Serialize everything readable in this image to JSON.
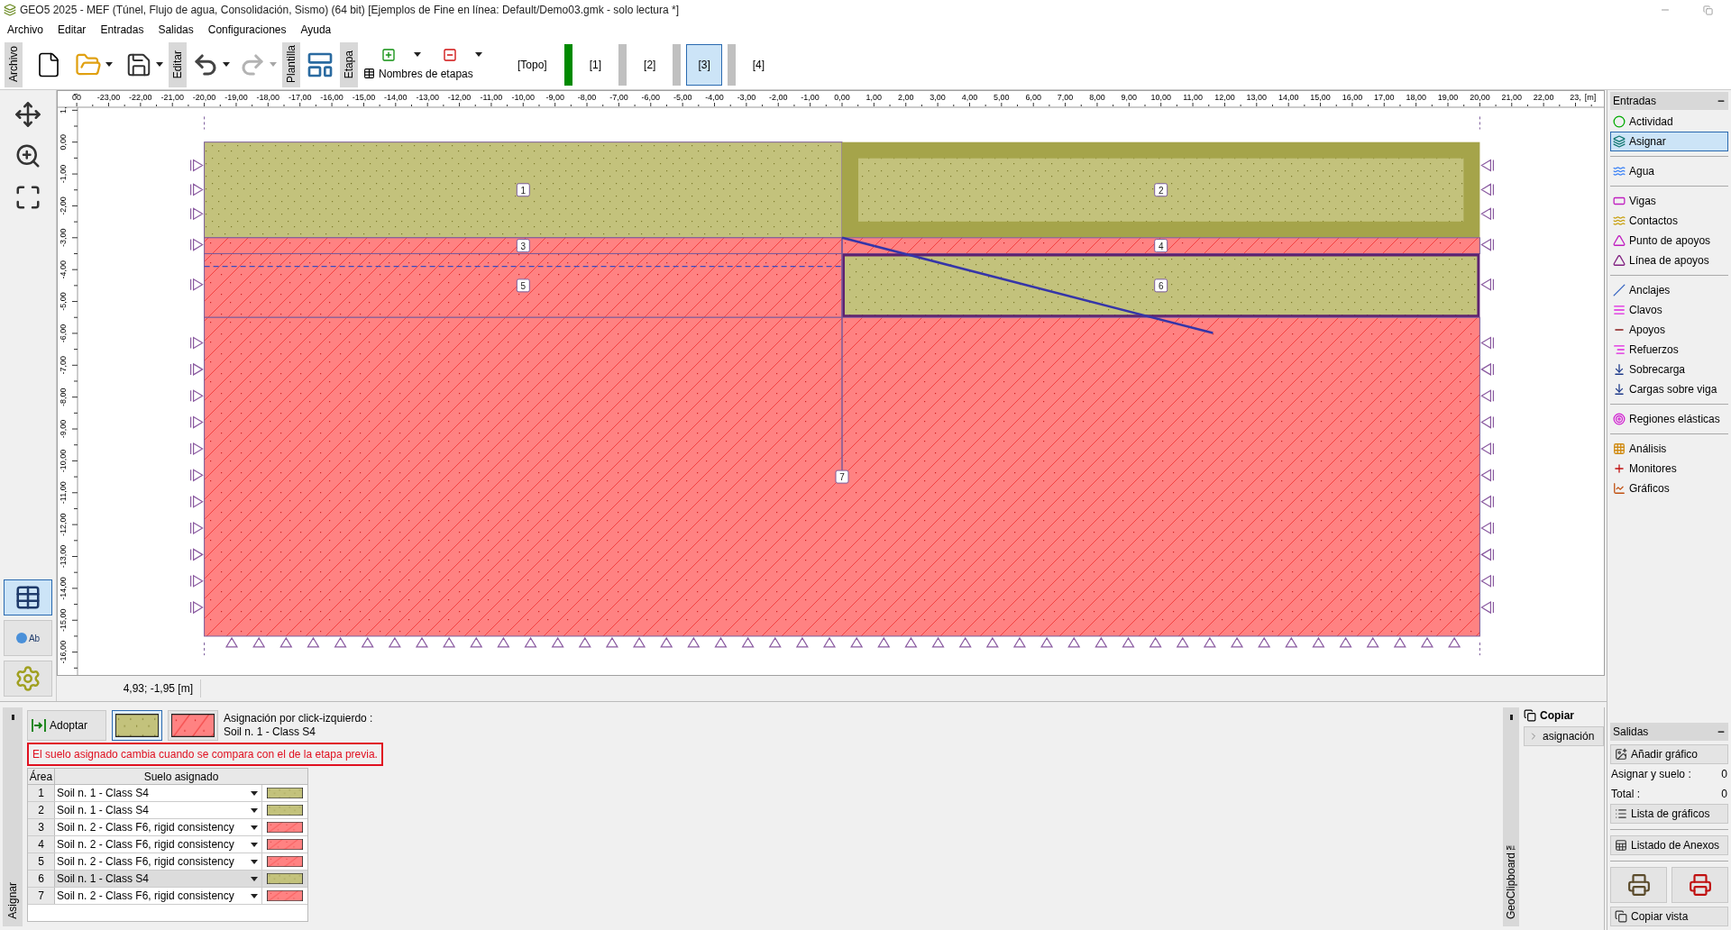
{
  "window": {
    "title": "GEO5 2025 - MEF (Túnel, Flujo de agua, Consolidación, Sismo) (64 bit) [Ejemplos de Fine en línea: Default/Demo03.gmk - solo lectura *]"
  },
  "menu": [
    "Archivo",
    "Editar",
    "Entradas",
    "Salidas",
    "Configuraciones",
    "Ayuda"
  ],
  "toolbar": {
    "groups": [
      "Archivo",
      "Editar",
      "Plantilla",
      "Etapa"
    ],
    "stage_names_button": "Nombres de etapas",
    "stages": [
      {
        "label": "[Topo]",
        "selected": false
      },
      {
        "label": "[1]",
        "selected": false,
        "color": "#008a00"
      },
      {
        "label": "[2]",
        "selected": false,
        "color": "#c0c0c0"
      },
      {
        "label": "[3]",
        "selected": true,
        "color": "#c0c0c0"
      },
      {
        "label": "[4]",
        "selected": false,
        "color": "#c0c0c0"
      }
    ]
  },
  "view_modes": [
    {
      "kind": "table",
      "selected": true
    },
    {
      "kind": "labels",
      "selected": false,
      "text": "Ab"
    },
    {
      "kind": "settings",
      "selected": false
    }
  ],
  "canvas": {
    "x_labels": [
      "00",
      "-23,00",
      "-22,00",
      "-21,00",
      "-20,00",
      "-19,00",
      "-18,00",
      "-17,00",
      "-16,00",
      "-15,00",
      "-14,00",
      "-13,00",
      "-12,00",
      "-11,00",
      "-10,00",
      "-9,00",
      "-8,00",
      "-7,00",
      "-6,00",
      "-5,00",
      "-4,00",
      "-3,00",
      "-2,00",
      "-1,00",
      "0,00",
      "1,00",
      "2,00",
      "3,00",
      "4,00",
      "5,00",
      "6,00",
      "7,00",
      "8,00",
      "9,00",
      "10,00",
      "11,00",
      "12,00",
      "13,00",
      "14,00",
      "15,00",
      "16,00",
      "17,00",
      "18,00",
      "19,00",
      "20,00",
      "21,00",
      "22,00",
      "23,",
      "[m]"
    ],
    "y_labels": [
      "1,",
      "0,00",
      "-1,00",
      "-2,00",
      "-3,00",
      "-4,00",
      "-5,00",
      "-6,00",
      "-7,00",
      "-8,00",
      "-9,00",
      "-10,00",
      "-11,00",
      "-12,00",
      "-13,00",
      "-14,00",
      "-15,00",
      "-16,00"
    ],
    "region_labels": [
      "1",
      "2",
      "3",
      "4",
      "5",
      "6",
      "7"
    ]
  },
  "status": {
    "coordinates": "4,93; -1,95 [m]"
  },
  "assign_panel": {
    "side_label": "Asignar",
    "adopt_button": "Adoptar",
    "swatches": [
      {
        "kind": "olive",
        "selected": true
      },
      {
        "kind": "red",
        "selected": false
      }
    ],
    "hint_title": "Asignación por click-izquierdo :",
    "hint_value": "Soil n. 1 - Class S4",
    "warning": "El suelo asignado cambia cuando se compara con el de la etapa previa.",
    "table": {
      "columns": [
        "Área",
        "Suelo asignado"
      ],
      "rows": [
        {
          "area": "1",
          "soil": "Soil n. 1 - Class S4",
          "kind": "olive",
          "selected": false
        },
        {
          "area": "2",
          "soil": "Soil n. 1 - Class S4",
          "kind": "olive",
          "selected": false
        },
        {
          "area": "3",
          "soil": "Soil n. 2 - Class F6, rigid consistency",
          "kind": "red",
          "selected": false
        },
        {
          "area": "4",
          "soil": "Soil n. 2 - Class F6, rigid consistency",
          "kind": "red",
          "selected": false
        },
        {
          "area": "5",
          "soil": "Soil n. 2 - Class F6, rigid consistency",
          "kind": "red",
          "selected": false
        },
        {
          "area": "6",
          "soil": "Soil n. 1 - Class S4",
          "kind": "olive",
          "selected": true
        },
        {
          "area": "7",
          "soil": "Soil n. 2 - Class F6, rigid consistency",
          "kind": "red",
          "selected": false
        }
      ]
    }
  },
  "clipboard": {
    "side_label": "GeoClipboard™",
    "title": "Copiar",
    "items": [
      "asignación"
    ]
  },
  "inputs_panel": {
    "title": "Entradas",
    "groups": [
      [
        {
          "label": "Actividad",
          "selected": false
        },
        {
          "label": "Asignar",
          "selected": true
        }
      ],
      [
        {
          "label": "Agua",
          "selected": false
        }
      ],
      [
        {
          "label": "Vigas",
          "selected": false
        },
        {
          "label": "Contactos",
          "selected": false
        },
        {
          "label": "Punto de apoyos",
          "selected": false
        },
        {
          "label": "Línea de apoyos",
          "selected": false
        }
      ],
      [
        {
          "label": "Anclajes",
          "selected": false
        },
        {
          "label": "Clavos",
          "selected": false
        },
        {
          "label": "Apoyos",
          "selected": false
        },
        {
          "label": "Refuerzos",
          "selected": false
        },
        {
          "label": "Sobrecarga",
          "selected": false
        },
        {
          "label": "Cargas sobre viga",
          "selected": false
        }
      ],
      [
        {
          "label": "Regiones elásticas",
          "selected": false
        }
      ],
      [
        {
          "label": "Análisis",
          "selected": false
        },
        {
          "label": "Monitores",
          "selected": false
        },
        {
          "label": "Gráficos",
          "selected": false
        }
      ]
    ]
  },
  "outputs_panel": {
    "title": "Salidas",
    "add_button": "Añadir gráfico",
    "counts": [
      {
        "label": "Asignar y suelo :",
        "value": "0"
      },
      {
        "label": "Total :",
        "value": "0"
      }
    ],
    "list_button": "Lista de gráficos",
    "appendix_button": "Listado de Anexos",
    "copy_view_button": "Copiar vista"
  }
}
